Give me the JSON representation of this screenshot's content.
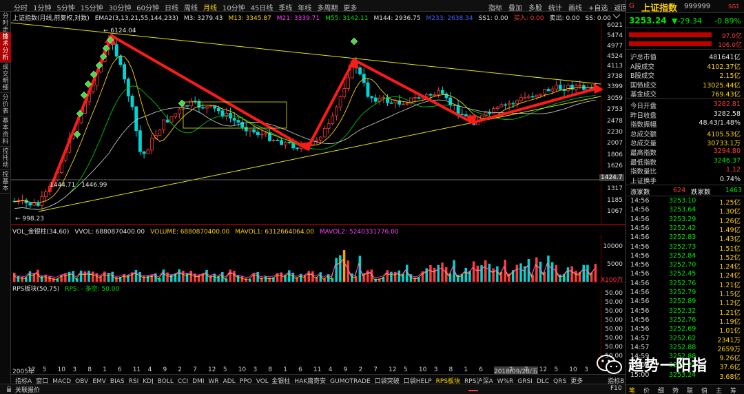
{
  "toolbar": {
    "periods": [
      "分时",
      "1分钟",
      "5分钟",
      "15分钟",
      "30分钟",
      "60分钟",
      "日线",
      "周线",
      "月线",
      "10分钟",
      "45日线",
      "季线",
      "年线",
      "多周期",
      "更多"
    ],
    "active_period": "月线",
    "tools": [
      "指标",
      "叠加",
      "多股",
      "统计",
      "画线",
      "+自选",
      "返回"
    ]
  },
  "left_tabs": [
    "分时走势",
    "技术分析",
    "成交明细",
    "分价表",
    "基本资料",
    "控托动",
    "控基本"
  ],
  "chart_header": {
    "title": "上证指数(月线,前复权,对数)",
    "ema_label": "EMA2(3,13,21,55,144,233)",
    "ma_values": [
      {
        "label": "M3: 3279.43",
        "color": "#e0e0e0"
      },
      {
        "label": "M13: 3345.87",
        "color": "#ffd200"
      },
      {
        "label": "M21: 3339.71",
        "color": "#ff40ff"
      },
      {
        "label": "M55: 3142.11",
        "color": "#00e600"
      },
      {
        "label": "M144: 2936.75",
        "color": "#e0e0e0"
      },
      {
        "label": "M233: 2638.34",
        "color": "#4060ff"
      },
      {
        "label": "SS1: 0.00",
        "color": "#e0e0e0"
      },
      {
        "label": "买入: 0.00",
        "color": "#ff3c3c"
      },
      {
        "label": "卖出: 0.00",
        "color": "#e0e0e0"
      },
      {
        "label": "SS: 0.00",
        "color": "#e0e0e0"
      }
    ]
  },
  "price_axis": [
    {
      "label": "6021",
      "value": 6021
    },
    {
      "label": "5474",
      "value": 5474
    },
    {
      "label": "4977",
      "value": 4977
    },
    {
      "label": "4524",
      "value": 4524
    },
    {
      "label": "4113",
      "value": 4113
    },
    {
      "label": "3738",
      "value": 3738
    },
    {
      "label": "3399",
      "value": 3399
    },
    {
      "label": "3059",
      "value": 3059
    },
    {
      "label": "2753",
      "value": 2753
    },
    {
      "label": "2478",
      "value": 2478
    },
    {
      "label": "2230",
      "value": 2230
    },
    {
      "label": "2007",
      "value": 2007
    },
    {
      "label": "1806",
      "value": 1806
    },
    {
      "label": "1626",
      "value": 1626
    },
    {
      "label": "1463",
      "value": 1463
    },
    {
      "label": "1317",
      "value": 1317
    },
    {
      "label": "1185",
      "value": 1185
    },
    {
      "label": "1067",
      "value": 1067
    }
  ],
  "price_marker": "1424.7",
  "annotations": {
    "high": "6124.04",
    "low": "998.23",
    "range": "1444.71 - 1446.99"
  },
  "vol_header": {
    "title": "VOL_金银柱(34,60)",
    "vvol": "VVOL: 6880870400.00",
    "volume": "VOLUME: 6880870400.00",
    "mavol1": "MAVOL1: 6312664064.00",
    "mavol2": "MAVOL2: 5240331776.00"
  },
  "vol_axis": [
    "10000",
    "5000"
  ],
  "vol_unit": "X100万",
  "rps_header": {
    "title": "RPS板块(50,75)",
    "rps": "RPS: - 多空: 50.00"
  },
  "rps_axis": [
    "50.00",
    "50.00",
    "50.00",
    "50.00",
    "50.00",
    "50.00",
    "50.00",
    "50.00"
  ],
  "time_axis": [
    "2005年",
    "12",
    "5",
    "10",
    "3",
    "8",
    "1",
    "6",
    "11",
    "4",
    "9",
    "2",
    "7",
    "12",
    "5",
    "10",
    "3",
    "8",
    "1",
    "6",
    "11",
    "4",
    "9",
    "2",
    "7",
    "12",
    "5",
    "10",
    "3",
    "8",
    "1",
    "6",
    "2018/09/28/五",
    "2",
    "7",
    "12",
    "5",
    "10",
    "3"
  ],
  "indicator_tabs": [
    "指标A",
    "窗口",
    "MACD",
    "OBV",
    "EMV",
    "BIAS",
    "RSI",
    "KDJ",
    "BOLL",
    "CCI",
    "DMI",
    "WR",
    "ADL",
    "PPO",
    "VOL_金银柱",
    "HAK庸奇安",
    "GUMOTRADE",
    "口袋突破",
    "口袋HELP",
    "RPS板块",
    "RPS沪深A",
    "W%R",
    "GRSI",
    "DLC",
    "QRS",
    "更多"
  ],
  "active_indicator": "RPS板块",
  "indicator_tabs_right": [
    "指标B",
    "模",
    "板",
    "月线"
  ],
  "status_bar": {
    "text": "关联报价",
    "right": "F10"
  },
  "right_panel": {
    "marker": "G",
    "name": "上证指数",
    "code": "999999",
    "tag": "SG1",
    "price": "3253.24",
    "change": "▼-29.34",
    "change_pct": "-0.89%",
    "bar1_value": "97.0亿",
    "bar2_value": "106.0亿",
    "stats1": [
      {
        "k": "沪总市值",
        "v": "481641亿",
        "c": "white"
      },
      {
        "k": "A股成交",
        "v": "4102.37亿",
        "c": "yellow"
      },
      {
        "k": "B股成交",
        "v": "2.15亿",
        "c": "yellow"
      },
      {
        "k": "国债成交",
        "v": "13025.44亿",
        "c": "yellow"
      },
      {
        "k": "基金成交",
        "v": "769.43亿",
        "c": "yellow"
      }
    ],
    "stats2": [
      {
        "k": "今日开盘",
        "v": "3282.81",
        "c": "red"
      },
      {
        "k": "昨日收盘",
        "v": "3282.58",
        "c": "white"
      },
      {
        "k": "指数振幅",
        "v": "48.43/1.48%",
        "c": "white"
      },
      {
        "k": "总成交额",
        "v": "4105.53亿",
        "c": "yellow"
      },
      {
        "k": "总成交量",
        "v": "30733.1万",
        "c": "yellow"
      },
      {
        "k": "最高指数",
        "v": "3294.80",
        "c": "red"
      },
      {
        "k": "最低指数",
        "v": "3246.37",
        "c": "green"
      },
      {
        "k": "指数量比",
        "v": "1.12",
        "c": "red"
      },
      {
        "k": "上证换手",
        "v": "0.74%",
        "c": "white"
      }
    ],
    "updown": {
      "up_label": "涨家数",
      "up": "624",
      "down_label": "跌家数",
      "down": "1463"
    },
    "ticks": [
      {
        "t": "14:56",
        "p": "3253.10",
        "v": "1.25亿"
      },
      {
        "t": "14:56",
        "p": "3253.64",
        "v": "1.30亿"
      },
      {
        "t": "14:56",
        "p": "3253.29",
        "v": "1.26亿"
      },
      {
        "t": "14:56",
        "p": "3252.42",
        "v": "1.49亿"
      },
      {
        "t": "14:56",
        "p": "3252.83",
        "v": "1.43亿"
      },
      {
        "t": "14:56",
        "p": "3252.73",
        "v": "1.51亿"
      },
      {
        "t": "14:56",
        "p": "3252.84",
        "v": "1.52亿"
      },
      {
        "t": "14:56",
        "p": "3252.70",
        "v": "1.24亿"
      },
      {
        "t": "14:56",
        "p": "3252.45",
        "v": "1.24亿"
      },
      {
        "t": "14:56",
        "p": "3252.76",
        "v": "1.21亿"
      },
      {
        "t": "14:56",
        "p": "3252.79",
        "v": "1.15亿"
      },
      {
        "t": "14:56",
        "p": "3252.89",
        "v": "1.12亿"
      },
      {
        "t": "14:56",
        "p": "3252.32",
        "v": "1.21亿"
      },
      {
        "t": "14:56",
        "p": "3252.76",
        "v": "1.19亿"
      },
      {
        "t": "14:56",
        "p": "3252.69",
        "v": "1.01亿"
      },
      {
        "t": "14:57",
        "p": "3252.62",
        "v": "2341万"
      },
      {
        "t": "14:57",
        "p": "3252.88",
        "v": "2659万"
      },
      {
        "t": "14:59",
        "p": "3252.88",
        "v": "9.26亿"
      },
      {
        "t": "15:00",
        "p": "3253.24",
        "v": "37.6亿"
      },
      {
        "t": "15:00",
        "p": "3253.24",
        "v": "3.68亿"
      }
    ],
    "bottom_tabs": [
      "笔",
      "价",
      "细",
      "势",
      "联",
      "值",
      "主",
      "筹"
    ]
  },
  "watermark": "趋势一阳指"
}
